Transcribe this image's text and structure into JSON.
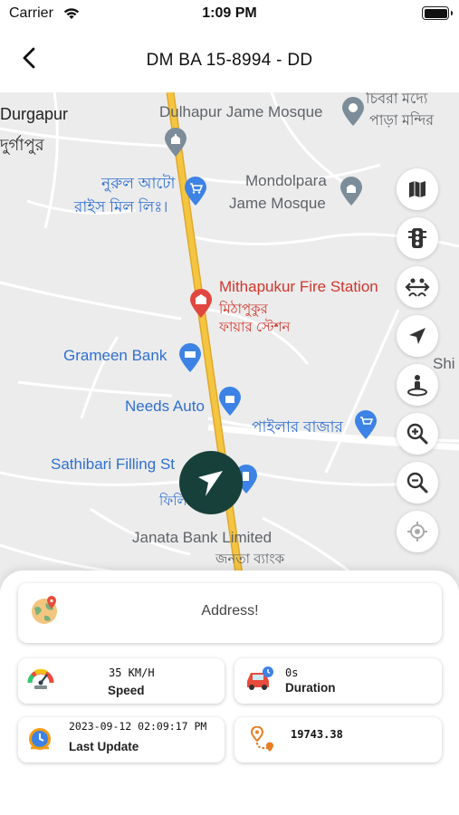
{
  "status_bar": {
    "carrier": "Carrier",
    "time": "1:09 PM"
  },
  "header": {
    "title": "DM BA 15-8994 - DD"
  },
  "map": {
    "labels": {
      "durgapur": "Durgapur",
      "durgapur_bn": "দুর্গাপুর",
      "dulhapur": "Dulhapur Jame Mosque",
      "chibra": "চিবরা মদ্যে",
      "para": "পাড়া মন্দির",
      "nurul1": "নুরুল আটো",
      "nurul2": "রাইস মিল লিঃ।",
      "mondolpara": "Mondolpara",
      "mondolpara2": "Jame Mosque",
      "fire": "Mithapukur Fire Station",
      "fire_bn1": "মিঠাপুকুর",
      "fire_bn2": "ফায়ার স্টেশন",
      "grameen": "Grameen Bank",
      "needs": "Needs Auto",
      "pailar": "পাইলার বাজার",
      "sathibari": "Sathibari Filling St",
      "fili": "ফিলি",
      "janata": "Janata Bank Limited",
      "janata_bn": "জনতা ব্যাংক",
      "shi": "Shi"
    }
  },
  "controls": [
    "map-layers-icon",
    "traffic-icon",
    "fit-bounds-icon",
    "navigate-icon",
    "street-view-icon",
    "zoom-in-icon",
    "zoom-out-icon",
    "my-location-icon"
  ],
  "info": {
    "address": "Address!",
    "speed_value": "35 KM/H",
    "speed_label": "Speed",
    "duration_value": "0s",
    "duration_label": "Duration",
    "last_update_value": "2023-09-12 02:09:17 PM",
    "last_update_label": "Last Update",
    "distance_value": "19743.38"
  },
  "colors": {
    "vehicle_marker": "#17403a",
    "road_main": "#f4c542",
    "poi_blue": "#2f6fd1",
    "poi_red": "#d2352d"
  }
}
